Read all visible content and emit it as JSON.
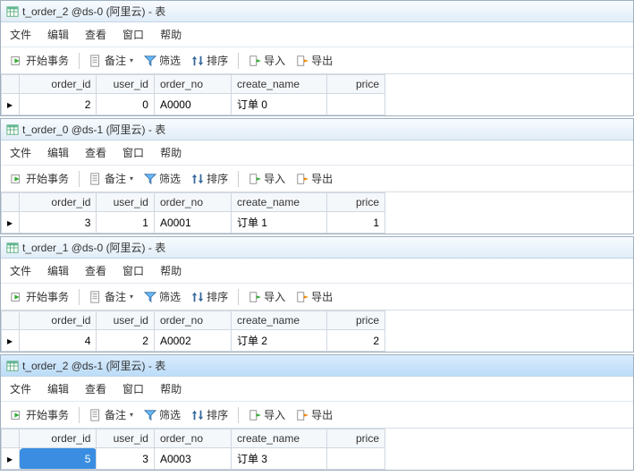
{
  "menus": {
    "file": "文件",
    "edit": "编辑",
    "view": "查看",
    "window": "窗口",
    "help": "帮助"
  },
  "toolbar": {
    "begin_tx": "开始事务",
    "remark": "备注",
    "filter": "筛选",
    "sort": "排序",
    "import": "导入",
    "export": "导出"
  },
  "columns": {
    "order_id": "order_id",
    "user_id": "user_id",
    "order_no": "order_no",
    "create_name": "create_name",
    "price": "price"
  },
  "panels": [
    {
      "title": "t_order_2 @ds-0 (阿里云) - 表",
      "row": {
        "order_id": "2",
        "user_id": "0",
        "order_no": "A0000",
        "create_name": "订单 0",
        "price": ""
      },
      "highlight": true,
      "selected": false,
      "active": false
    },
    {
      "title": "t_order_0 @ds-1 (阿里云) - 表",
      "row": {
        "order_id": "3",
        "user_id": "1",
        "order_no": "A0001",
        "create_name": "订单 1",
        "price": "1"
      },
      "highlight": true,
      "selected": false,
      "active": false
    },
    {
      "title": "t_order_1 @ds-0 (阿里云) - 表",
      "row": {
        "order_id": "4",
        "user_id": "2",
        "order_no": "A0002",
        "create_name": "订单 2",
        "price": "2"
      },
      "highlight": true,
      "selected": false,
      "active": false
    },
    {
      "title": "t_order_2 @ds-1 (阿里云) - 表",
      "row": {
        "order_id": "5",
        "user_id": "3",
        "order_no": "A0003",
        "create_name": "订单 3",
        "price": ""
      },
      "highlight": true,
      "selected": true,
      "active": true
    }
  ]
}
